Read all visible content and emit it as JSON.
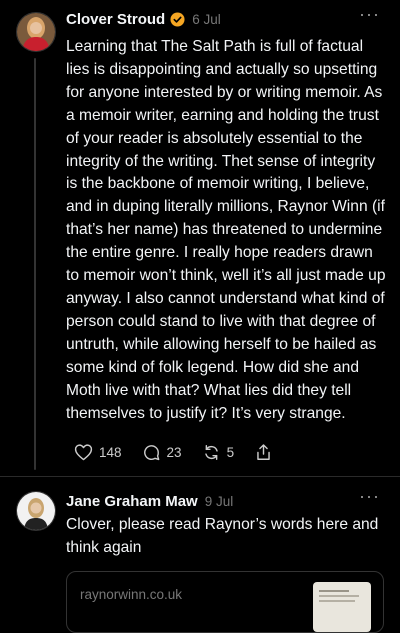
{
  "post1": {
    "author": "Clover Stroud",
    "date": "6 Jul",
    "text": "Learning that The Salt Path is full of factual lies is disappointing and actually so upsetting for anyone interested by or writing memoir. As a memoir writer, earning and holding the trust of your reader is absolutely essential to the integrity of the writing. Thet sense of integrity is the backbone of memoir writing, I believe, and in duping literally millions, Raynor Winn (if that’s her name) has threatened to undermine the entire genre. I really hope readers drawn to memoir won’t think, well it’s all just made up anyway. I also cannot understand what kind of person could stand to live with that degree of untruth, while allowing herself to be hailed as some kind of folk legend. How did she and Moth live with that? What lies did they tell themselves to justify it? It’s very strange.",
    "likes": "148",
    "replies": "23",
    "reposts": "5"
  },
  "post2": {
    "author": "Jane Graham Maw",
    "date": "9 Jul",
    "text": "Clover, please read Raynor’s words here and think again",
    "link_domain": "raynorwinn.co.uk"
  },
  "colors": {
    "verified": "#f5a623",
    "background": "#000000",
    "text": "#f3f5f7",
    "muted": "#777777"
  }
}
